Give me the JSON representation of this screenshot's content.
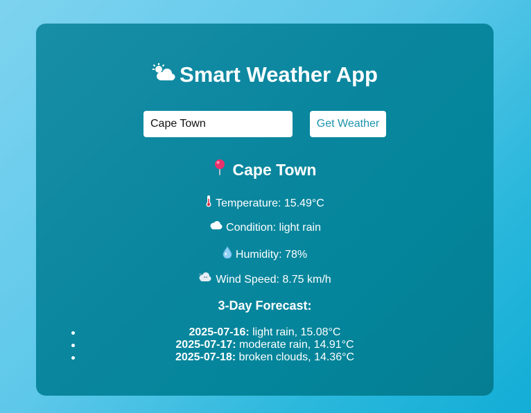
{
  "app": {
    "title": "Smart Weather App",
    "title_icon": "sun-behind-cloud-icon"
  },
  "search": {
    "value": "Cape Town",
    "button_label": "Get Weather"
  },
  "current": {
    "city": "Cape Town",
    "temperature_label": "Temperature: 15.49°C",
    "condition_label": "Condition: light rain",
    "humidity_label": "Humidity: 78%",
    "wind_label": "Wind Speed: 8.75 km/h"
  },
  "forecast": {
    "title": "3-Day Forecast:",
    "items": [
      {
        "date": "2025-07-16:",
        "desc": " light rain, 15.08°C"
      },
      {
        "date": "2025-07-17:",
        "desc": " moderate rain, 14.91°C"
      },
      {
        "date": "2025-07-18:",
        "desc": " broken clouds, 14.36°C"
      }
    ]
  },
  "colors": {
    "button_text": "#1b93ad",
    "card": "#0b879f",
    "pin": "#e8336b"
  }
}
